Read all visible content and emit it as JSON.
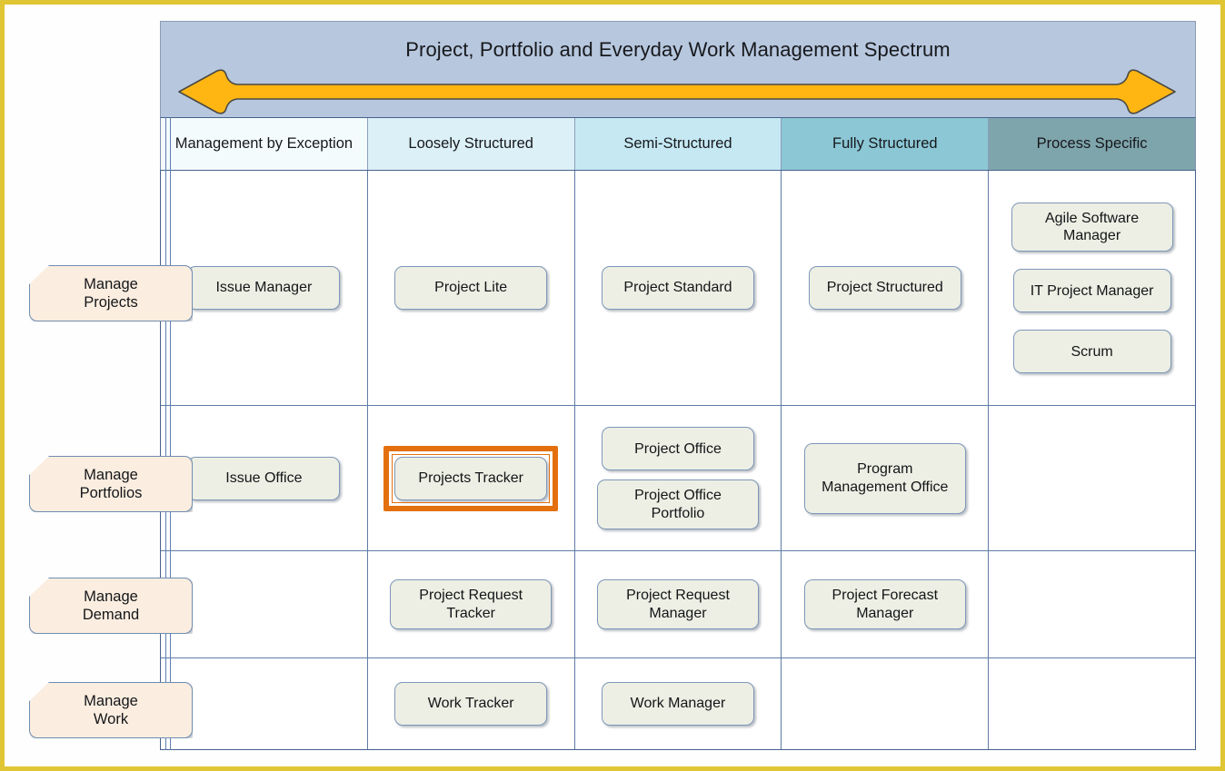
{
  "frame": {
    "border_color": "#e0c534"
  },
  "spectrum": {
    "title": "Project, Portfolio and Everyday Work Management Spectrum",
    "arrow_name": "double-headed-arrow-icon",
    "arrow_color": "#FFB612",
    "band_color": "#B7C7DE"
  },
  "columns": [
    {
      "label": "Management by Exception",
      "color": "#F4FBFD"
    },
    {
      "label": "Loosely Structured",
      "color": "#DCF0F7"
    },
    {
      "label": "Semi-Structured",
      "color": "#C5E8F3"
    },
    {
      "label": "Fully Structured",
      "color": "#8CC7D6"
    },
    {
      "label": "Process Specific",
      "color": "#7FA5AC"
    }
  ],
  "rows": [
    {
      "label": "Manage Projects",
      "label_line1": "Manage",
      "label_line2": "Projects",
      "cells": [
        {
          "nodes": [
            "Issue Manager"
          ],
          "highlighted": false
        },
        {
          "nodes": [
            "Project Lite"
          ],
          "highlighted": false
        },
        {
          "nodes": [
            "Project Standard"
          ],
          "highlighted": false
        },
        {
          "nodes": [
            "Project Structured"
          ],
          "highlighted": false
        },
        {
          "nodes": [
            "Agile Software Manager",
            "IT Project Manager",
            "Scrum"
          ],
          "highlighted": false
        }
      ]
    },
    {
      "label": "Manage Portfolios",
      "label_line1": "Manage",
      "label_line2": "Portfolios",
      "cells": [
        {
          "nodes": [
            "Issue Office"
          ],
          "highlighted": false
        },
        {
          "nodes": [
            "Projects Tracker"
          ],
          "highlighted": true
        },
        {
          "nodes": [
            "Project Office",
            "Project Office Portfolio"
          ],
          "highlighted": false
        },
        {
          "nodes": [
            "Program Management Office"
          ],
          "highlighted": false
        },
        {
          "nodes": [],
          "highlighted": false
        }
      ]
    },
    {
      "label": "Manage Demand",
      "label_line1": "Manage",
      "label_line2": "Demand",
      "cells": [
        {
          "nodes": [],
          "highlighted": false
        },
        {
          "nodes": [
            "Project Request Tracker"
          ],
          "highlighted": false
        },
        {
          "nodes": [
            "Project Request Manager"
          ],
          "highlighted": false
        },
        {
          "nodes": [
            "Project Forecast Manager"
          ],
          "highlighted": false
        },
        {
          "nodes": [],
          "highlighted": false
        }
      ]
    },
    {
      "label": "Manage Work",
      "label_line1": "Manage",
      "label_line2": "Work",
      "cells": [
        {
          "nodes": [],
          "highlighted": false
        },
        {
          "nodes": [
            "Work Tracker"
          ],
          "highlighted": false
        },
        {
          "nodes": [
            "Work Manager"
          ],
          "highlighted": false
        },
        {
          "nodes": [],
          "highlighted": false
        },
        {
          "nodes": [],
          "highlighted": false
        }
      ]
    }
  ],
  "highlight": {
    "color": "#E3700D",
    "target": "Projects Tracker"
  }
}
